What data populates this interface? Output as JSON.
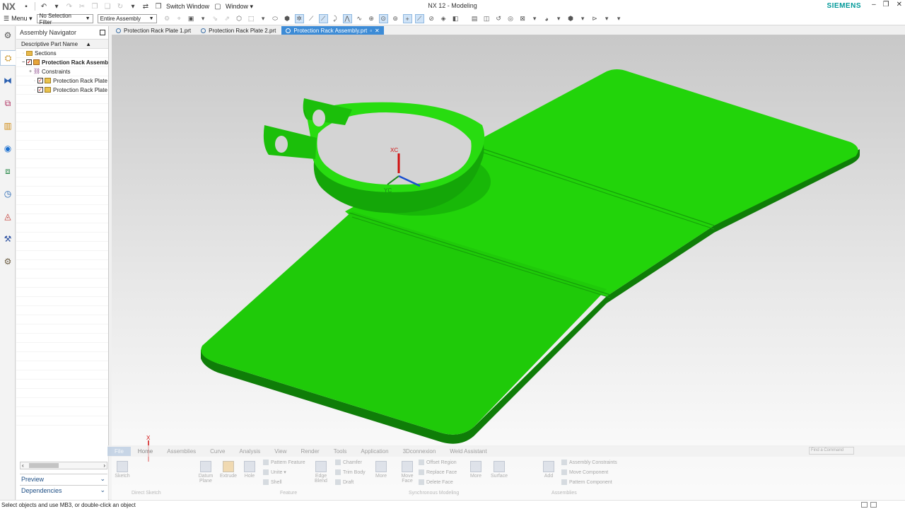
{
  "app": {
    "logo": "NX",
    "title": "NX 12 - Modeling",
    "brand": "SIEMENS"
  },
  "quick_access": {
    "switch_window": "Switch Window",
    "window_menu": "Window ▾"
  },
  "selection_bar": {
    "menu_label": "Menu ▾",
    "filter_value": "No Selection Filter",
    "scope_value": "Entire Assembly"
  },
  "navigator": {
    "title": "Assembly Navigator",
    "column_header": "Descriptive Part Name",
    "items": [
      {
        "label": "Sections"
      },
      {
        "label": "Protection Rack Assemb"
      },
      {
        "label": "Constraints"
      },
      {
        "label": "Protection Rack Plate"
      },
      {
        "label": "Protection Rack Plate"
      }
    ],
    "sections": [
      {
        "label": "Preview"
      },
      {
        "label": "Dependencies"
      }
    ]
  },
  "tabs": [
    {
      "label": "Protection Rack Plate 1.prt"
    },
    {
      "label": "Protection Rack Plate 2.prt"
    },
    {
      "label": "Protection Rack Assembly.prt"
    }
  ],
  "viewport": {
    "model_color": "#22d40a",
    "axis_labels": {
      "xc": "XC",
      "yc": "YC"
    },
    "triad_label": "X"
  },
  "ribbon": {
    "tabs": [
      "File",
      "Home",
      "Assemblies",
      "Curve",
      "Analysis",
      "View",
      "Render",
      "Tools",
      "Application",
      "3Dconnexion",
      "Weld Assistant"
    ],
    "find_placeholder": "Find a Command",
    "buttons": {
      "sketch": "Sketch",
      "datum_plane": "Datum Plane",
      "extrude": "Extrude",
      "hole": "Hole",
      "pattern_feature": "Pattern Feature",
      "unite": "Unite ▾",
      "shell": "Shell",
      "edge_blend": "Edge Blend",
      "chamfer": "Chamfer",
      "trim_body": "Trim Body",
      "draft": "Draft",
      "more1": "More",
      "move_face": "Move Face",
      "offset_region": "Offset Region",
      "replace_face": "Replace Face",
      "delete_face": "Delete Face",
      "more2": "More",
      "surface": "Surface",
      "add": "Add",
      "assembly_constraints": "Assembly Constraints",
      "move_component": "Move Component",
      "pattern_component": "Pattern Component"
    },
    "groups": {
      "direct_sketch": "Direct Sketch",
      "feature": "Feature",
      "synchronous": "Synchronous Modeling",
      "assemblies": "Assemblies"
    }
  },
  "status": {
    "message": "Select objects and use MB3, or double-click an object"
  }
}
